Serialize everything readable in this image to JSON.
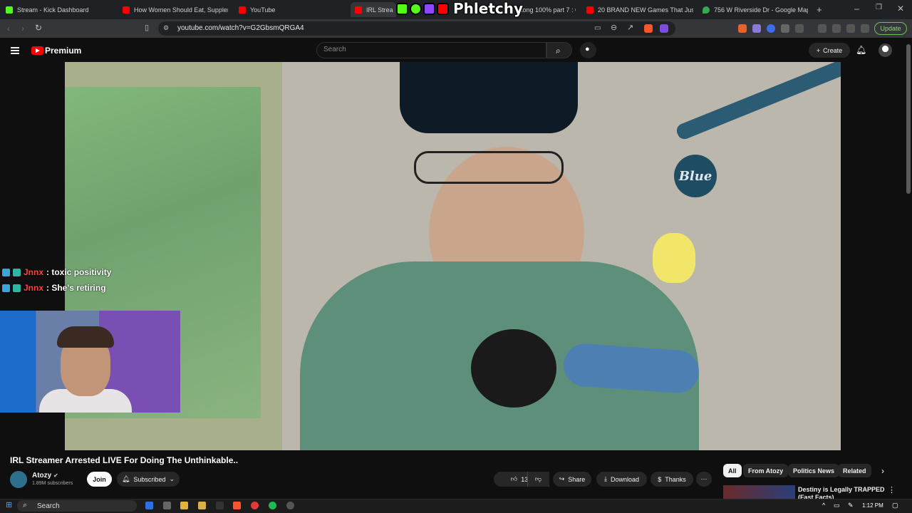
{
  "browser": {
    "tabs": [
      {
        "title": "Stream - Kick Dashboard",
        "icon": "kick-icon",
        "color": "#53fc18"
      },
      {
        "title": "How Women Should Eat, Supplemen",
        "icon": "youtube-icon",
        "color": "#ff0000"
      },
      {
        "title": "YouTube",
        "icon": "youtube-icon",
        "color": "#ff0000"
      },
      {
        "title": "IRL Strea",
        "icon": "youtube-icon",
        "color": "#ff0000"
      },
      {
        "title": "ukong 100% part 7 : C",
        "icon": "youtube-icon",
        "color": "#ff0000"
      },
      {
        "title": "20 BRAND NEW Games That Just Ge",
        "icon": "youtube-icon",
        "color": "#ff0000"
      },
      {
        "title": "756 W Riverside Dr - Google Maps",
        "icon": "maps-icon",
        "color": "#34a853"
      }
    ],
    "url": "youtube.com/watch?v=G2GbsmQRGA4",
    "update_label": "Update"
  },
  "overlay": {
    "streamer_name": "Phletchy"
  },
  "youtube": {
    "brand": "Premium",
    "search_placeholder": "Search",
    "create_label": "Create"
  },
  "chat": [
    {
      "user": "Jnnx",
      "message": ": toxic positivity"
    },
    {
      "user": "Jnnx",
      "message": ": She's retiring"
    }
  ],
  "video": {
    "title": "IRL Streamer Arrested LIVE For Doing The Unthinkable..",
    "channel": "Atozy",
    "subscribers": "1.89M subscribers",
    "join_label": "Join",
    "subscribed_label": "Subscribed",
    "likes": "13K",
    "share_label": "Share",
    "download_label": "Download",
    "thanks_label": "Thanks"
  },
  "chips": [
    "All",
    "From Atozy",
    "Politics News",
    "Related"
  ],
  "related": {
    "title": "Destiny is Legally TRAPPED (Fast Facts)"
  },
  "taskbar": {
    "search_label": "Search",
    "time": "1:12 PM"
  },
  "colors": {
    "yt_red": "#ff0000",
    "background": "#0f0f0f",
    "chat_user": "#ff4040"
  }
}
